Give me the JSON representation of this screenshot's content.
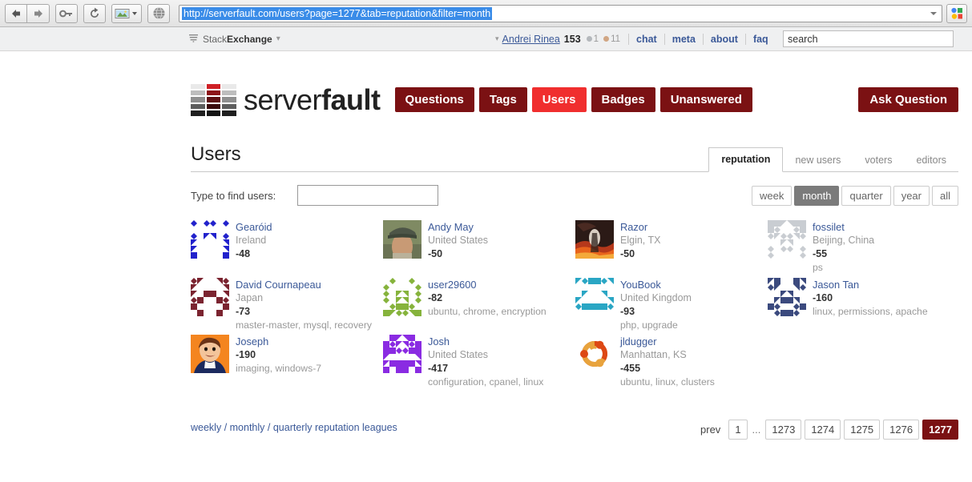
{
  "browser": {
    "url": "http://serverfault.com/users?page=1277&tab=reputation&filter=month",
    "toolbar_icons": [
      "back-icon",
      "forward-icon",
      "key-icon",
      "reload-icon",
      "image-icon",
      "dropdown-caret-icon",
      "globe-icon"
    ],
    "google_button_label": "Google"
  },
  "topbar": {
    "network_label_prefix": "Stack",
    "network_label_suffix": "Exchange",
    "network_caret": "▾",
    "user_caret": "▾",
    "username": "Andrei Rinea",
    "reputation": "153",
    "silver_badges": "1",
    "bronze_badges": "11",
    "links": [
      {
        "label": "chat"
      },
      {
        "label": "meta"
      },
      {
        "label": "about"
      },
      {
        "label": "faq"
      }
    ],
    "search_value": "search"
  },
  "site": {
    "logo_text_light": "server",
    "logo_text_bold": "fault",
    "nav": [
      {
        "label": "Questions",
        "active": false
      },
      {
        "label": "Tags",
        "active": false
      },
      {
        "label": "Users",
        "active": true
      },
      {
        "label": "Badges",
        "active": false
      },
      {
        "label": "Unanswered",
        "active": false
      }
    ],
    "ask_question": "Ask Question"
  },
  "main": {
    "title": "Users",
    "tabs": [
      {
        "label": "reputation",
        "active": true
      },
      {
        "label": "new users",
        "active": false
      },
      {
        "label": "voters",
        "active": false
      },
      {
        "label": "editors",
        "active": false
      }
    ],
    "find_label": "Type to find users:",
    "find_value": "",
    "find_placeholder": "",
    "period_filters": [
      {
        "label": "week",
        "active": false
      },
      {
        "label": "month",
        "active": true
      },
      {
        "label": "quarter",
        "active": false
      },
      {
        "label": "year",
        "active": false
      },
      {
        "label": "all",
        "active": false
      }
    ]
  },
  "users": [
    {
      "name": "Gearóid",
      "location": "Ireland",
      "reputation": "-48",
      "tags": "",
      "extra": "",
      "avatar": {
        "type": "identicon",
        "color": "#2222cc",
        "seed": 11
      }
    },
    {
      "name": "Andy May",
      "location": "United States",
      "reputation": "-50",
      "tags": "",
      "extra": "",
      "avatar": {
        "type": "photo",
        "variant": "man-cap"
      }
    },
    {
      "name": "Razor",
      "location": "Elgin, TX",
      "reputation": "-50",
      "tags": "",
      "extra": "",
      "avatar": {
        "type": "photo",
        "variant": "fiery-art"
      }
    },
    {
      "name": "fossilet",
      "location": "Beijing, China",
      "reputation": "-55",
      "tags": "",
      "extra": "ps",
      "avatar": {
        "type": "identicon",
        "color": "#c9cdd2",
        "seed": 3
      }
    },
    {
      "name": "David Cournapeau",
      "location": "Japan",
      "reputation": "-73",
      "tags": "master-master, mysql, recovery",
      "extra": "",
      "avatar": {
        "type": "identicon",
        "color": "#7b2430",
        "seed": 7
      }
    },
    {
      "name": "user29600",
      "location": "",
      "reputation": "-82",
      "tags": "ubuntu, chrome, encryption",
      "extra": "",
      "avatar": {
        "type": "identicon",
        "color": "#86b33c",
        "seed": 5
      }
    },
    {
      "name": "YouBook",
      "location": "United Kingdom",
      "reputation": "-93",
      "tags": "php, upgrade",
      "extra": "",
      "avatar": {
        "type": "identicon",
        "color": "#2aa6c4",
        "seed": 9
      }
    },
    {
      "name": "Jason Tan",
      "location": "",
      "reputation": "-160",
      "tags": "linux, permissions, apache",
      "extra": "",
      "avatar": {
        "type": "identicon",
        "color": "#3b4a7e",
        "seed": 13
      }
    },
    {
      "name": "Joseph",
      "location": "",
      "reputation": "-190",
      "tags": "imaging, windows-7",
      "extra": "",
      "avatar": {
        "type": "photo",
        "variant": "comic-face"
      }
    },
    {
      "name": "Josh",
      "location": "United States",
      "reputation": "-417",
      "tags": "configuration, cpanel, linux",
      "extra": "",
      "avatar": {
        "type": "identicon",
        "color": "#8a2be2",
        "seed": 17
      }
    },
    {
      "name": "jldugger",
      "location": "Manhattan, KS",
      "reputation": "-455",
      "tags": "ubuntu, linux, clusters",
      "extra": "",
      "avatar": {
        "type": "logo",
        "variant": "ubuntu"
      }
    }
  ],
  "footer": {
    "leagues_weekly": "weekly",
    "leagues_sep1": " / ",
    "leagues_monthly": "monthly",
    "leagues_sep2": " / ",
    "leagues_quarterly": "quarterly reputation leagues",
    "pager_prev": "prev",
    "pages": [
      {
        "label": "1",
        "current": false,
        "dots": false
      },
      {
        "label": "...",
        "current": false,
        "dots": true
      },
      {
        "label": "1273",
        "current": false,
        "dots": false
      },
      {
        "label": "1274",
        "current": false,
        "dots": false
      },
      {
        "label": "1275",
        "current": false,
        "dots": false
      },
      {
        "label": "1276",
        "current": false,
        "dots": false
      },
      {
        "label": "1277",
        "current": true,
        "dots": false
      }
    ]
  },
  "colors": {
    "brand_dark": "#7b1113",
    "brand_bright": "#f02e2e",
    "link": "#3b5998",
    "muted": "#999999"
  }
}
